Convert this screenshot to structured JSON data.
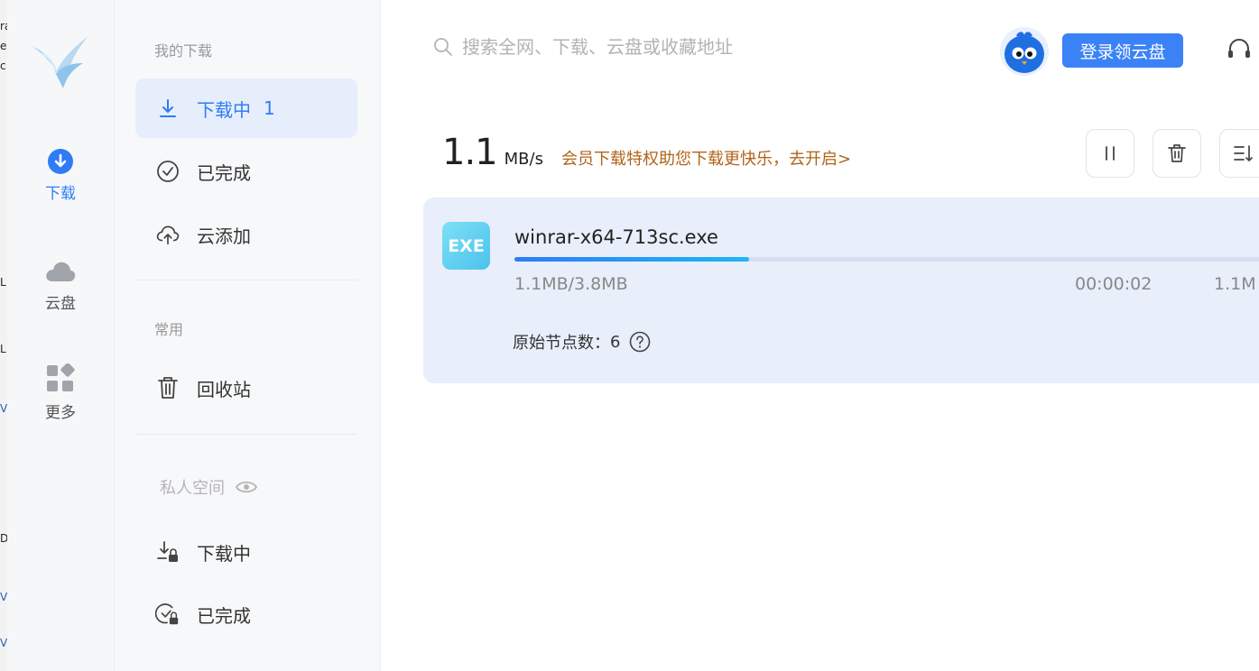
{
  "background_window": {
    "edge_chars": [
      "ra",
      "e",
      "c",
      "L",
      "L",
      "V",
      "D",
      "V",
      "V"
    ]
  },
  "rail": {
    "items": [
      {
        "label": "下载",
        "icon": "download-circle-icon",
        "active": true
      },
      {
        "label": "云盘",
        "icon": "cloud-icon",
        "active": false
      },
      {
        "label": "更多",
        "icon": "grid-icon",
        "active": false
      }
    ]
  },
  "nav": {
    "my_downloads_title": "我的下载",
    "downloading_label": "下载中",
    "downloading_count": "1",
    "completed_label": "已完成",
    "cloud_add_label": "云添加",
    "common_title": "常用",
    "recycle_label": "回收站",
    "private_title": "私人空间",
    "private_downloading_label": "下载中",
    "private_completed_label": "已完成"
  },
  "header": {
    "search_placeholder": "搜索全网、下载、云盘或收藏地址",
    "login_label": "登录领云盘"
  },
  "speed": {
    "value": "1.1",
    "unit": "MB/s",
    "promo": "会员下载特权助您下载更快乐，去开启>"
  },
  "task": {
    "type_badge": "EXE",
    "filename": "winrar-x64-713sc.exe",
    "progress_fraction": 0.31,
    "size_text": "1.1MB/3.8MB",
    "time_remaining": "00:00:02",
    "rate": "1.1M",
    "nodes_label": "原始节点数：",
    "nodes_count": "6"
  },
  "colors": {
    "accent": "#2f7cf6",
    "promo": "#b0641a",
    "card_bg": "#e9eefb",
    "login_bg": "#3b82f6"
  }
}
